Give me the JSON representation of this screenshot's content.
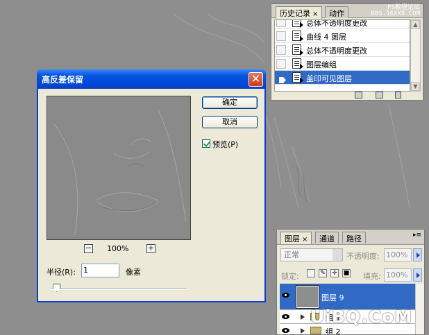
{
  "history_panel": {
    "tabs": [
      {
        "label": "历史记录",
        "close": "×"
      },
      {
        "label": "动作"
      }
    ],
    "watermark": [
      "PS教程论坛",
      "BBS.16XX8.COM"
    ],
    "items": [
      {
        "label": "总体不透明度更改"
      },
      {
        "label": "曲线 4 图层"
      },
      {
        "label": "总体不透明度更改"
      },
      {
        "label": "图层编组"
      },
      {
        "label": "盖印可见图层",
        "selected": true
      }
    ],
    "footer_icons": [
      "new-document-icon",
      "snapshot-icon",
      "trash-icon"
    ]
  },
  "dialog": {
    "title": "高反差保留",
    "close_glyph": "✕",
    "zoom": {
      "minus": "−",
      "plus": "+",
      "value": "100%"
    },
    "ok_label": "确定",
    "cancel_label": "取消",
    "preview_label": "预览(P)",
    "preview_checked": true,
    "radius_label": "半径(R):",
    "radius_value": "1",
    "radius_unit": "像素",
    "radius_slider_fraction": 0.02
  },
  "layers_panel": {
    "tabs": [
      {
        "label": "图层",
        "close": "×"
      },
      {
        "label": "通道"
      },
      {
        "label": "路径"
      }
    ],
    "menu_glyph": "▸≡",
    "blend_mode": "正常",
    "opacity_label": "不透明度:",
    "opacity_value": "100%",
    "lock_label": "锁定:",
    "fill_label": "填充:",
    "fill_value": "100%",
    "layers": [
      {
        "name": "图层 9",
        "selected": true
      },
      {
        "name": "组 1"
      },
      {
        "name": "组 2"
      }
    ]
  },
  "site_watermark": "UiBQ.CoM",
  "colors": {
    "canvas": "#8e8e8e",
    "selection": "#316ac5",
    "title_bar": "#0054e3",
    "close": "#cd3c17"
  }
}
